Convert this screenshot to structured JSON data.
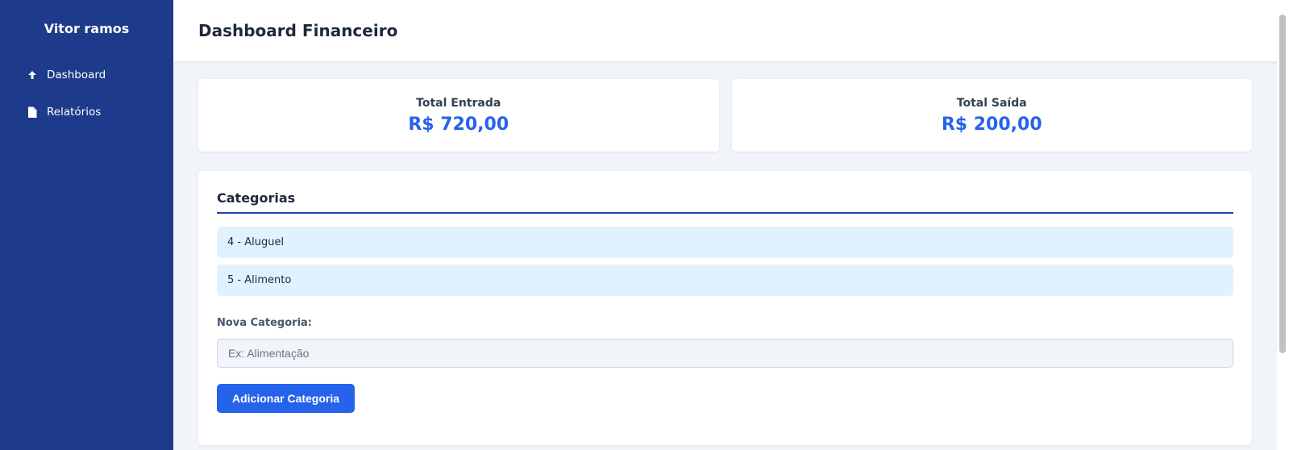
{
  "sidebar": {
    "brand": "Vitor ramos",
    "items": [
      {
        "label": "Dashboard",
        "icon": "arrow-up-icon"
      },
      {
        "label": "Relatórios",
        "icon": "document-icon"
      }
    ]
  },
  "header": {
    "title": "Dashboard Financeiro"
  },
  "stats": [
    {
      "label": "Total Entrada",
      "value": "R$ 720,00"
    },
    {
      "label": "Total Saída",
      "value": "R$ 200,00"
    }
  ],
  "categories": {
    "title": "Categorias",
    "items": [
      "4 - Aluguel",
      "5 - Alimento"
    ],
    "new_label": "Nova Categoria:",
    "placeholder": "Ex: Alimentação",
    "value": "",
    "add_button": "Adicionar Categoria"
  },
  "colors": {
    "sidebar_bg": "#1e3a8a",
    "accent": "#2563eb",
    "category_bg": "#e0f2fe",
    "page_bg": "#f1f5f9"
  }
}
